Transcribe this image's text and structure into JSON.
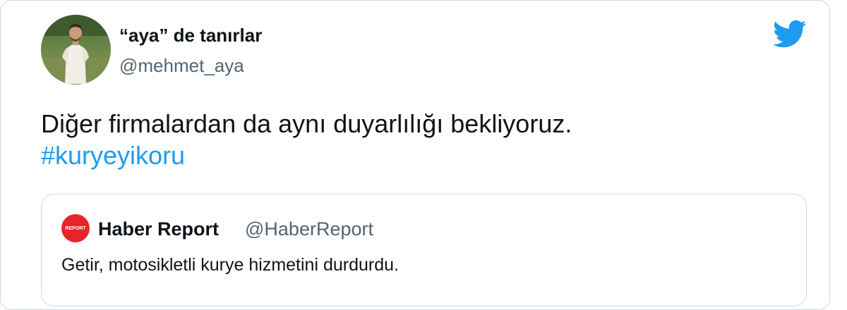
{
  "tweet": {
    "author": {
      "display_name": "“aya” de tanırlar",
      "handle": "@mehmet_aya"
    },
    "text": "Diğer firmalardan da aynı duyarlılığı bekliyoruz.",
    "hashtag": "#kuryeyikoru"
  },
  "quoted_tweet": {
    "author": {
      "display_name": "Haber Report",
      "handle": "@HaberReport",
      "avatar_text": "REPORT"
    },
    "text": "Getir, motosikletli kurye hizmetini durdurdu."
  },
  "icons": {
    "platform": "twitter-bird-icon"
  },
  "colors": {
    "brand_blue": "#1d9bf0",
    "quote_avatar_red": "#e8242b"
  }
}
